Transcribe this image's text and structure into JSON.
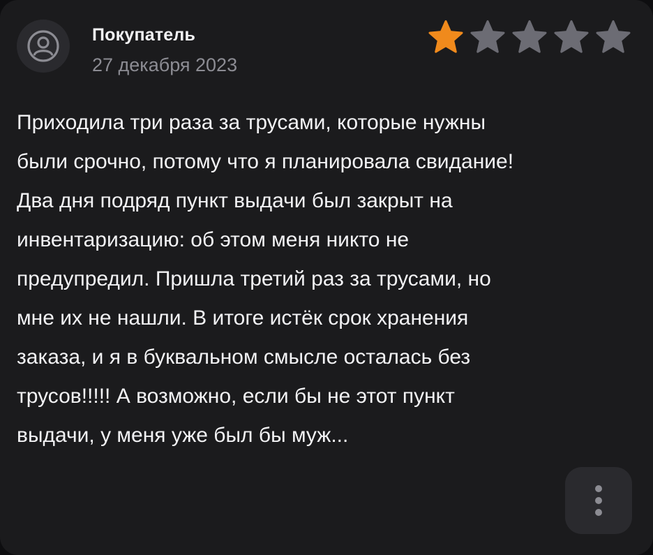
{
  "review": {
    "author": "Покупатель",
    "date": "27 декабря 2023",
    "rating": 1,
    "max_rating": 5,
    "text": "Приходила три раза за трусами, которые нужны\nбыли срочно, потому что я планировала свидание!\nДва дня подряд пункт выдачи был закрыт на\nинвентаризацию: об этом меня никто не\nпредупредил. Пришла третий раз за трусами, но\nмне их не нашли. В итоге истёк срок хранения\nзаказа, и я в буквальном смысле осталась без\nтрусов!!!!! А возможно, если бы не этот пункт\nвыдачи, у меня уже был бы муж..."
  },
  "icons": {
    "avatar": "user-circle-icon",
    "star": "star-icon",
    "more": "more-vertical-icon"
  },
  "colors": {
    "background": "#1b1b1d",
    "star_filled": "#f08a1c",
    "star_empty": "#6c6c74",
    "text_primary": "#f2f2f4",
    "text_secondary": "#8c8c93",
    "button_bg": "#2a2a2e"
  }
}
